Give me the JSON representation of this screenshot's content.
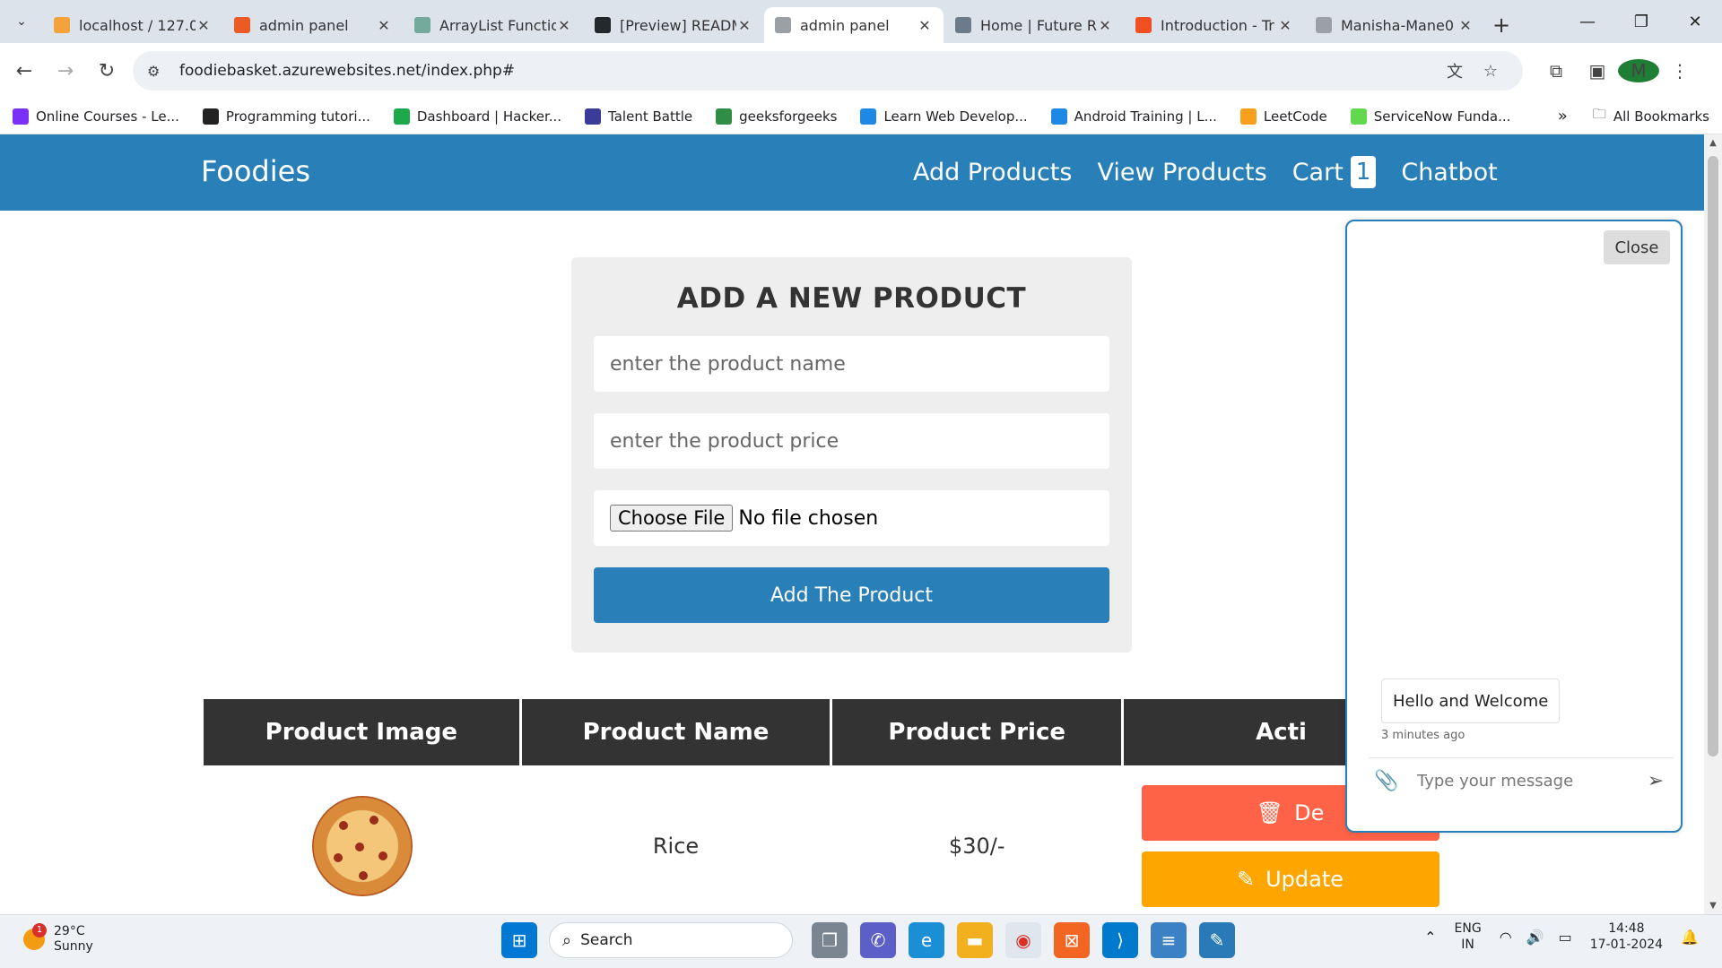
{
  "browser": {
    "tabs": [
      {
        "title": "localhost / 127.0",
        "color": "#f4a23b",
        "active": false
      },
      {
        "title": "admin panel",
        "color": "#ee5a24",
        "active": false
      },
      {
        "title": "ArrayList Functio",
        "color": "#74aa9c",
        "active": false
      },
      {
        "title": "[Preview] READM",
        "color": "#24292e",
        "active": false
      },
      {
        "title": "admin panel",
        "color": "#9aa0a6",
        "active": true
      },
      {
        "title": "Home | Future R",
        "color": "#6c7a89",
        "active": false
      },
      {
        "title": "Introduction - Tr",
        "color": "#f25022",
        "active": false
      },
      {
        "title": "Manisha-Mane0",
        "color": "#9aa0a6",
        "active": false
      }
    ],
    "url": "foodiebasket.azurewebsites.net/index.php#",
    "bookmarks": [
      {
        "label": "Online Courses - Le...",
        "color": "#7b2ff7"
      },
      {
        "label": "Programming tutori...",
        "color": "#222222"
      },
      {
        "label": "Dashboard | Hacker...",
        "color": "#1ba94c"
      },
      {
        "label": "Talent Battle",
        "color": "#3b3b98"
      },
      {
        "label": "geeksforgeeks",
        "color": "#2f8d46"
      },
      {
        "label": "Learn Web Develop...",
        "color": "#1e88e5"
      },
      {
        "label": "Android Training | L...",
        "color": "#1e88e5"
      },
      {
        "label": "LeetCode",
        "color": "#f89f1b"
      },
      {
        "label": "ServiceNow Funda...",
        "color": "#62d84e"
      }
    ],
    "all_bookmarks": "All Bookmarks",
    "avatar_letter": "M"
  },
  "header": {
    "logo": "Foodies",
    "nav": {
      "add": "Add Products",
      "view": "View Products",
      "cart": "Cart",
      "cart_count": "1",
      "chatbot": "Chatbot"
    }
  },
  "form": {
    "title": "ADD A NEW PRODUCT",
    "name_placeholder": "enter the product name",
    "price_placeholder": "enter the product price",
    "choose_file": "Choose File",
    "no_file": "No file chosen",
    "submit": "Add The Product"
  },
  "table": {
    "headers": [
      "Product Image",
      "Product Name",
      "Product Price",
      "Acti"
    ],
    "rows": [
      {
        "name": "Rice",
        "price": "$30/-",
        "delete": "De",
        "update": "Update"
      }
    ]
  },
  "chat": {
    "close": "Close",
    "message": "Hello and Welcome",
    "time": "3 minutes ago",
    "placeholder": "Type your message"
  },
  "taskbar": {
    "weather_temp": "29°C",
    "weather_desc": "Sunny",
    "weather_badge": "1",
    "search": "Search",
    "lang1": "ENG",
    "lang2": "IN",
    "time": "14:48",
    "date": "17-01-2024"
  },
  "colors": {
    "brand": "#2980b9",
    "delete": "#ff6347",
    "update": "#ffa500",
    "table_header": "#333333"
  }
}
